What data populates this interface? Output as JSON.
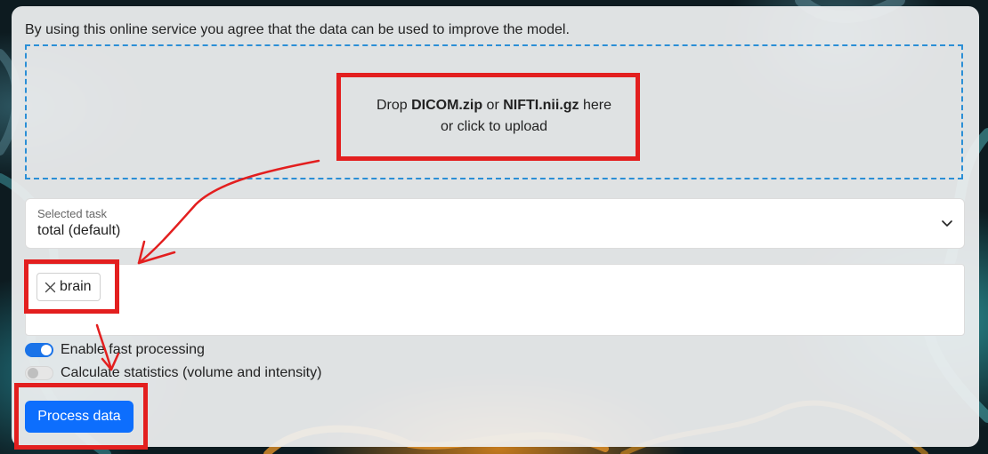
{
  "notice": "By using this online service you agree that the data can be used to improve the model.",
  "dropzone": {
    "prefix": "Drop ",
    "format1": "DICOM.zip",
    "or_word": " or ",
    "format2": "NIFTI.nii.gz",
    "suffix": " here",
    "line2": "or click to upload"
  },
  "task_select": {
    "label": "Selected task",
    "value": "total (default)",
    "icon": "chevron-down-icon"
  },
  "roi_tags": [
    {
      "label": "brain",
      "remove_icon": "close-icon"
    }
  ],
  "toggles": [
    {
      "label": "Enable fast processing",
      "on": true
    },
    {
      "label": "Calculate statistics (volume and intensity)",
      "on": false
    }
  ],
  "process_button": "Process data",
  "colors": {
    "accent": "#0d6efd",
    "dropzone_border": "#2b8fd6",
    "annotation": "#e31f1f"
  }
}
